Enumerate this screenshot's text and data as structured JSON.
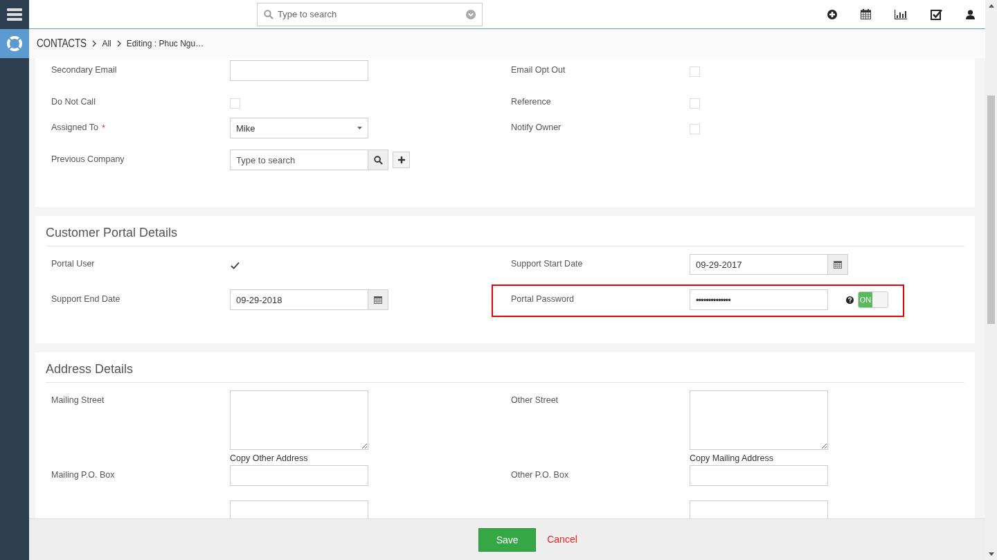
{
  "top_bar": {
    "search": {
      "placeholder": "Type to search"
    }
  },
  "breadcrumb": [
    "CONTACTS",
    "All",
    "Editing : Phuc Ngu…"
  ],
  "sections": [
    {
      "rows": [
        [
          {
            "label": "Secondary Email",
            "kind": "text"
          },
          {
            "label": "Email Opt Out",
            "kind": "checkbox",
            "checked": false
          }
        ],
        [
          {
            "label": "Do Not Call",
            "kind": "checkbox",
            "checked": false
          },
          {
            "label": "Reference",
            "kind": "checkbox",
            "checked": false
          }
        ],
        [
          {
            "label": "Assigned To",
            "required_mark": "*",
            "kind": "select",
            "value": "Mike"
          },
          {
            "label": "Notify Owner",
            "kind": "checkbox",
            "checked": false
          }
        ],
        [
          {
            "label": "Previous Company",
            "kind": "search",
            "placeholder": "Type to search"
          }
        ]
      ]
    },
    {
      "title": "Customer Portal Details",
      "rows": [
        [
          {
            "label": "Portal User",
            "kind": "checkbox",
            "checked": true
          },
          {
            "label": "Support Start Date",
            "kind": "date",
            "value": "09-29-2017"
          }
        ],
        [
          {
            "label": "Support End Date",
            "kind": "date",
            "value": "09-29-2018"
          },
          {
            "label": "Portal Password",
            "kind": "password",
            "value": "••••••••••••••",
            "toggle": {
              "label": "ON",
              "on": true
            },
            "highlighted": true
          }
        ]
      ]
    },
    {
      "title": "Address Details",
      "rows": [
        [
          {
            "label": "Mailing Street",
            "kind": "textarea",
            "link": "Copy Other Address"
          },
          {
            "label": "Other Street",
            "kind": "textarea",
            "link": "Copy Mailing Address"
          }
        ],
        [
          {
            "label": "Mailing P.O. Box",
            "kind": "text"
          },
          {
            "label": "Other P.O. Box",
            "kind": "text"
          }
        ],
        [
          {
            "kind": "text"
          },
          {
            "kind": "text"
          }
        ]
      ]
    }
  ],
  "footer": {
    "save": "Save",
    "cancel": "Cancel"
  }
}
